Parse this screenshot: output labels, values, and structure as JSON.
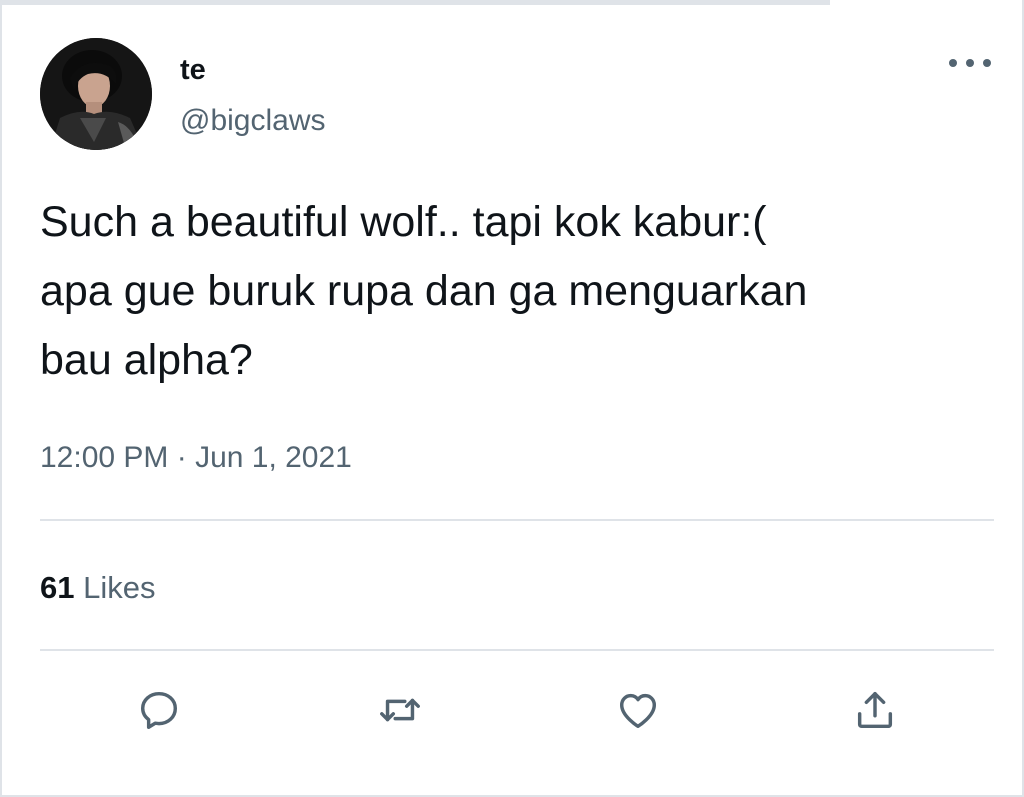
{
  "tweet": {
    "author": {
      "display_name": "te",
      "handle": "@bigclaws",
      "avatar_icon": "profile-photo"
    },
    "more_icon": "more-horizontal-icon",
    "text_lines": [
      "Such a beautiful wolf.. tapi kok kabur:(",
      "apa gue buruk rupa dan ga menguarkan",
      "bau alpha?"
    ],
    "timestamp": "12:00 PM · Jun 1, 2021",
    "stats": {
      "likes_count": "61",
      "likes_label": "Likes"
    },
    "actions": [
      {
        "name": "reply",
        "icon": "reply-icon"
      },
      {
        "name": "retweet",
        "icon": "retweet-icon"
      },
      {
        "name": "like",
        "icon": "heart-icon"
      },
      {
        "name": "share",
        "icon": "share-icon"
      }
    ]
  },
  "colors": {
    "text_primary": "#0f1419",
    "text_secondary": "#536471",
    "divider": "#dfe3e8",
    "background": "#ffffff"
  }
}
